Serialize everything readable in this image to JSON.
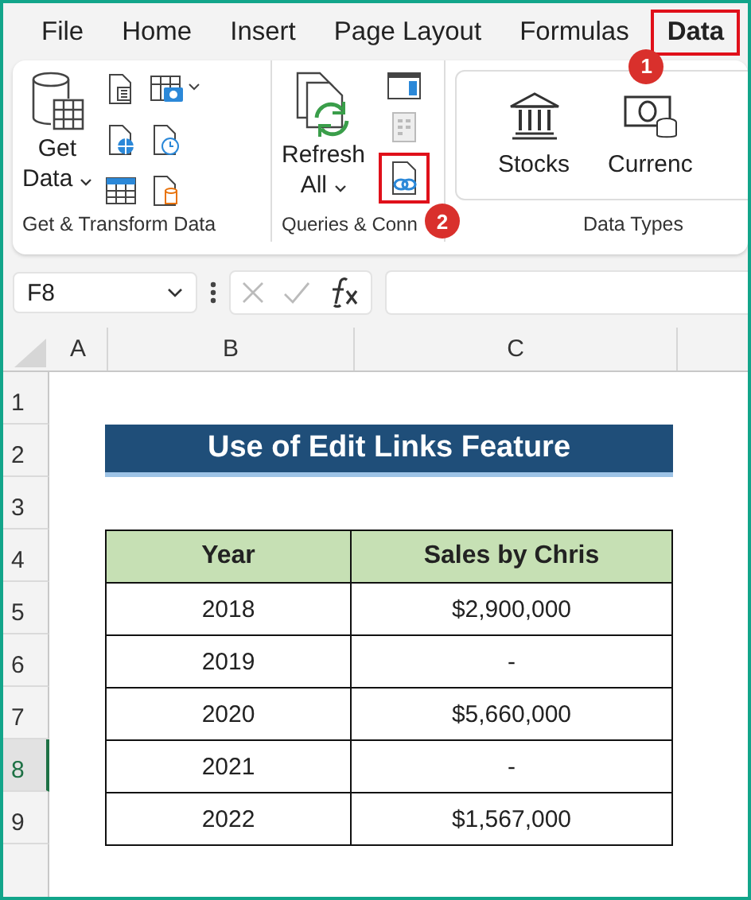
{
  "tabs": [
    {
      "label": "File",
      "selected": false,
      "highlighted": false
    },
    {
      "label": "Home",
      "selected": false,
      "highlighted": false
    },
    {
      "label": "Insert",
      "selected": false,
      "highlighted": false
    },
    {
      "label": "Page Layout",
      "selected": false,
      "highlighted": false
    },
    {
      "label": "Formulas",
      "selected": false,
      "highlighted": false
    },
    {
      "label": "Data",
      "selected": true,
      "highlighted": true
    }
  ],
  "ribbon": {
    "groups": [
      {
        "kind": "get",
        "label": "Get & Transform Data",
        "big_button": [
          "Get",
          "Data"
        ]
      },
      {
        "kind": "queries",
        "label": "Queries & Conn",
        "big_button": [
          "Refresh",
          "All"
        ],
        "edit_links_highlighted": true
      },
      {
        "kind": "types",
        "label": "Data Types",
        "items": [
          "Stocks",
          "Currenc"
        ]
      }
    ]
  },
  "callouts": [
    "1",
    "2"
  ],
  "formula_bar": {
    "name_box": "F8"
  },
  "columns": [
    "A",
    "B",
    "C"
  ],
  "rows": [
    {
      "label": "1",
      "selected": false
    },
    {
      "label": "2",
      "selected": false
    },
    {
      "label": "3",
      "selected": false
    },
    {
      "label": "4",
      "selected": false
    },
    {
      "label": "5",
      "selected": false
    },
    {
      "label": "6",
      "selected": false
    },
    {
      "label": "7",
      "selected": false
    },
    {
      "label": "8",
      "selected": true
    },
    {
      "label": "9",
      "selected": false
    }
  ],
  "sheet": {
    "title": "Use of Edit Links Feature",
    "table": {
      "columns": [
        "Year",
        "Sales by Chris"
      ],
      "rows": [
        [
          "2018",
          "$2,900,000"
        ],
        [
          "2019",
          "-"
        ],
        [
          "2020",
          "$5,660,000"
        ],
        [
          "2021",
          "-"
        ],
        [
          "2022",
          "$1,567,000"
        ]
      ]
    }
  }
}
